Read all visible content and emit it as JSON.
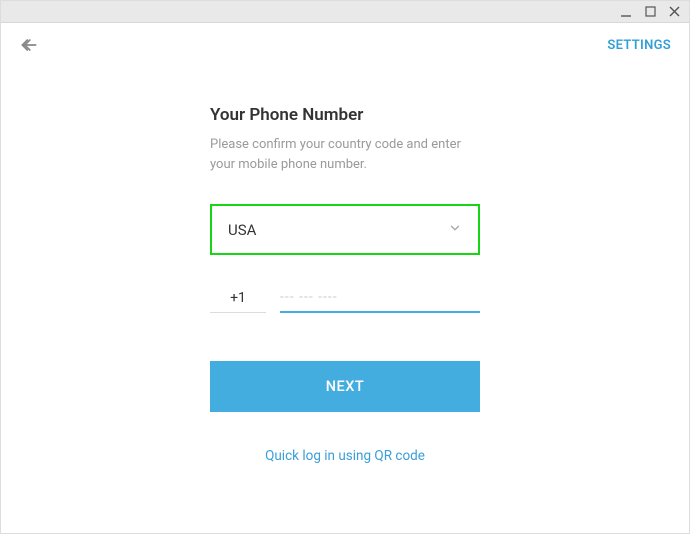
{
  "header": {
    "settings_label": "SETTINGS"
  },
  "main": {
    "title": "Your Phone Number",
    "subtitle": "Please confirm your country code and enter your mobile phone number.",
    "country": "USA",
    "country_code": "+1",
    "phone_placeholder": "--- --- ----",
    "next_label": "NEXT",
    "qr_link": "Quick log in using QR code"
  },
  "colors": {
    "accent": "#44ade0",
    "highlight_border": "#17d417"
  }
}
